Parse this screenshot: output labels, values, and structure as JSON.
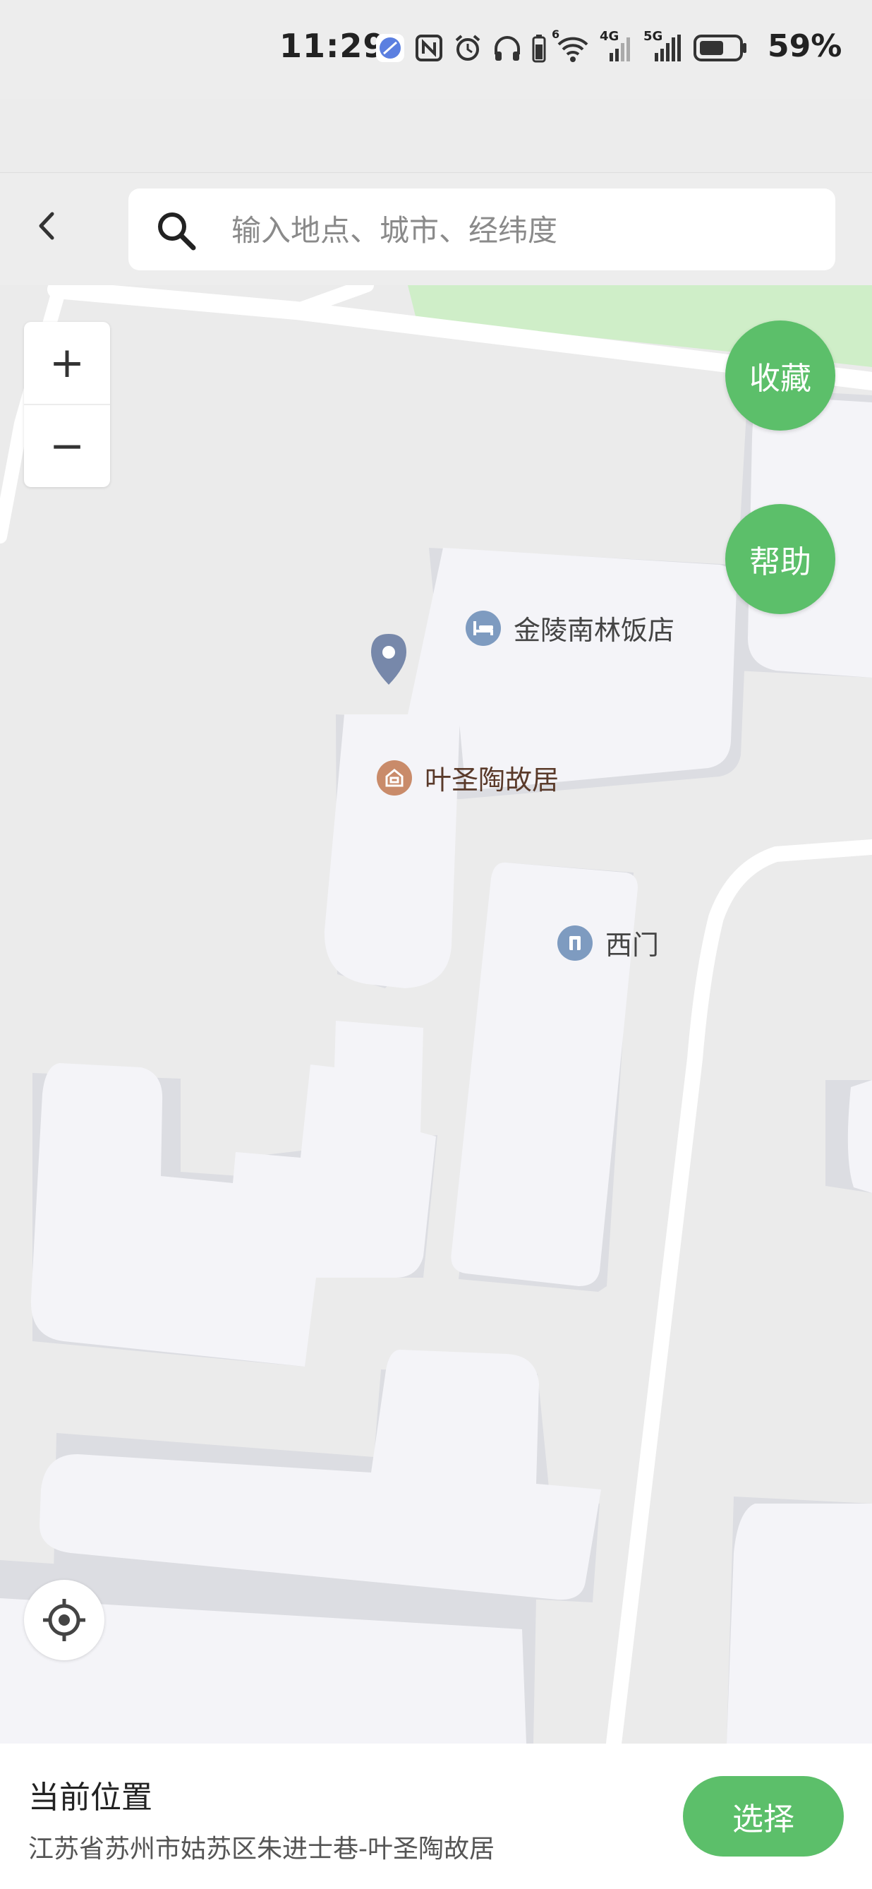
{
  "status_bar": {
    "time": "11:29",
    "battery_percent": "59%",
    "network_1": "4G",
    "network_2": "5G",
    "wifi_badge": "6",
    "icons": [
      "app-icon",
      "nfc-icon",
      "alarm-icon",
      "headphones-icon",
      "battery-small-icon",
      "wifi-icon",
      "signal-4g-icon",
      "signal-5g-icon",
      "battery-icon"
    ]
  },
  "header": {
    "back_icon": "chevron-left-icon",
    "search": {
      "placeholder": "输入地点、城市、经纬度",
      "value": "",
      "icon": "search-icon"
    }
  },
  "map": {
    "zoom_in_label": "+",
    "zoom_out_label": "−",
    "favorite_label": "收藏",
    "help_label": "帮助",
    "locate_icon": "target-icon",
    "pois": [
      {
        "name": "金陵南林饭店",
        "icon": "hotel-icon",
        "color": "#7e9bc0",
        "text_color": "#444444"
      },
      {
        "name": "叶圣陶故居",
        "icon": "landmark-icon",
        "color": "#c98b6a",
        "text_color": "#5a3a2a"
      },
      {
        "name": "西门",
        "icon": "gate-icon",
        "color": "#7e9bc0",
        "text_color": "#444444"
      }
    ],
    "marker_icon": "map-pin-icon"
  },
  "bottom": {
    "title": "当前位置",
    "address": "江苏省苏州市姑苏区朱进士巷-叶圣陶故居",
    "select_label": "选择"
  },
  "colors": {
    "accent_green": "#5cbf6a",
    "building": "#f4f4f8",
    "building_shadow": "#dcdde2",
    "road": "#ffffff",
    "park": "#cfeec8",
    "ground": "#ebebeb"
  }
}
